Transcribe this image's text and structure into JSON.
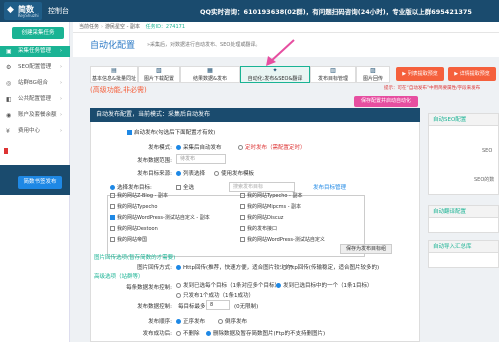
{
  "topbar": {
    "logo_mark": "◆",
    "logo_text": "简数",
    "logo_sub": "KeyShuzhi",
    "app_title": "控制台",
    "contact": "QQ实时咨询：610193638(02群)，有问题扫码咨询(24小时)，专业版以上群695421375"
  },
  "sidebar": {
    "create_label": "创建采集任务",
    "items": [
      {
        "label": "采集任务管理",
        "icon": "▣",
        "arrow": "›"
      },
      {
        "label": "SEO配置管理",
        "icon": "⚙",
        "arrow": "›"
      },
      {
        "label": "站群BG组合",
        "icon": "◎",
        "arrow": "›"
      },
      {
        "label": "公共配置管理",
        "icon": "◧",
        "arrow": "›"
      },
      {
        "label": "账户及套餐余额",
        "icon": "◉",
        "arrow": "›"
      },
      {
        "label": "费用中心",
        "icon": "¥",
        "arrow": "›"
      }
    ],
    "bottom_button": "简数书签发布"
  },
  "breadcrumb": {
    "home": "当前任务",
    "item1": "游民星空 - 副本",
    "task_label": "任务ID：274171"
  },
  "header": {
    "title": "自动化配置",
    "subtitle": "»采集后，对数据进行自动发布、SEO处理或翻译。"
  },
  "tabs": [
    {
      "label": "基本信息&批量同址",
      "icon": "▤"
    },
    {
      "label": "图片下载配置",
      "icon": "▧"
    },
    {
      "label": "结果数据&发布",
      "icon": "▦"
    },
    {
      "label": "自动化:发布&SEO&翻译",
      "icon": "✦"
    },
    {
      "label": "发布目标管理",
      "icon": "▥"
    },
    {
      "label": "图片回传",
      "icon": "▨"
    }
  ],
  "action_buttons": {
    "publish_browse": "▶ 列表提取预览",
    "detail_browse": "▶ 详情提取预览"
  },
  "warning": "(高级功能,非必需)",
  "warning_tip": "提示：可在“自动发布”中用简要属性/字段来发布",
  "save_button": "保存配置并启动自动化",
  "panel": {
    "title": "自动发布配置，当前模式：采集后自动发布",
    "enable_label": "启动发布(勾选后下面配置才有效)",
    "publish_mode_label": "发布模式:",
    "mode_opt1": "采集后自动发布",
    "mode_opt2": "定时发布（需配置定时）",
    "data_range_label": "发布数据范围:",
    "data_range_value": "待发布",
    "target_source_label": "发布目标来源:",
    "source_opt1": "列表选择",
    "source_opt2": "使用发布模板",
    "target_label": "选择发布目标:",
    "select_all": "全选",
    "search_placeholder": "搜索发布目标",
    "manage_link": "发布目标管理",
    "targets_left": [
      "我的网站Z-Blog - 副本",
      "我的网站Typecho",
      "我的网站WordPress-测试站自定义 - 副本",
      "我的网站Destoon",
      "我的网站帝国"
    ],
    "targets_right": [
      "我的网站Typecho - 副本",
      "我的网站Mipcms - 副本",
      "我的网站Discuz",
      "我的发布接口",
      "我的网站WordPress-测试站自定义"
    ],
    "save_target_btn": "保存为发布目标组",
    "image_section": "图片回传选项(暂存简数的才需要)",
    "image_mode_label": "图片回传方式:",
    "image_opt1": "Http回传(推荐，快速方便，适合图片较少的)",
    "image_opt2": "Ftp回传(传输稳定，适合图片较多的)",
    "advanced_section": "高级选项（站群等）",
    "each_data_label": "每条数据发布控制:",
    "each_opt1": "发到已选每个目标（1条对应多个目标）",
    "each_opt2": "发到已选目标中的一个（1条1目标）",
    "each_opt3": "只发布1个成功（1条1成功）",
    "count_label": "发布数据控制:",
    "count_prefix": "每目标最多",
    "count_value": "8",
    "count_suffix": "(0无限制)",
    "order_label": "发布顺序:",
    "order_opt1": "正序发布",
    "order_opt2": "倒序发布",
    "success_label": "发布成功后:",
    "success_opt1": "不删除",
    "success_opt2": "删除数据及暂存简数图片(Ftp的不支持删图片)"
  },
  "right_panels": [
    {
      "title": "自动SEO配置",
      "line1": "SEO",
      "line2": "SEO的数"
    },
    {
      "title": "自动翻译配置",
      "line1": "",
      "line2": ""
    },
    {
      "title": "自动导入汇总库",
      "line1": "",
      "line2": ""
    }
  ],
  "colors": {
    "brand": "#1a4b6e",
    "accent": "#1ab394",
    "warning": "#f5603c",
    "pink": "#e64ea0",
    "blue": "#1e88e5"
  }
}
